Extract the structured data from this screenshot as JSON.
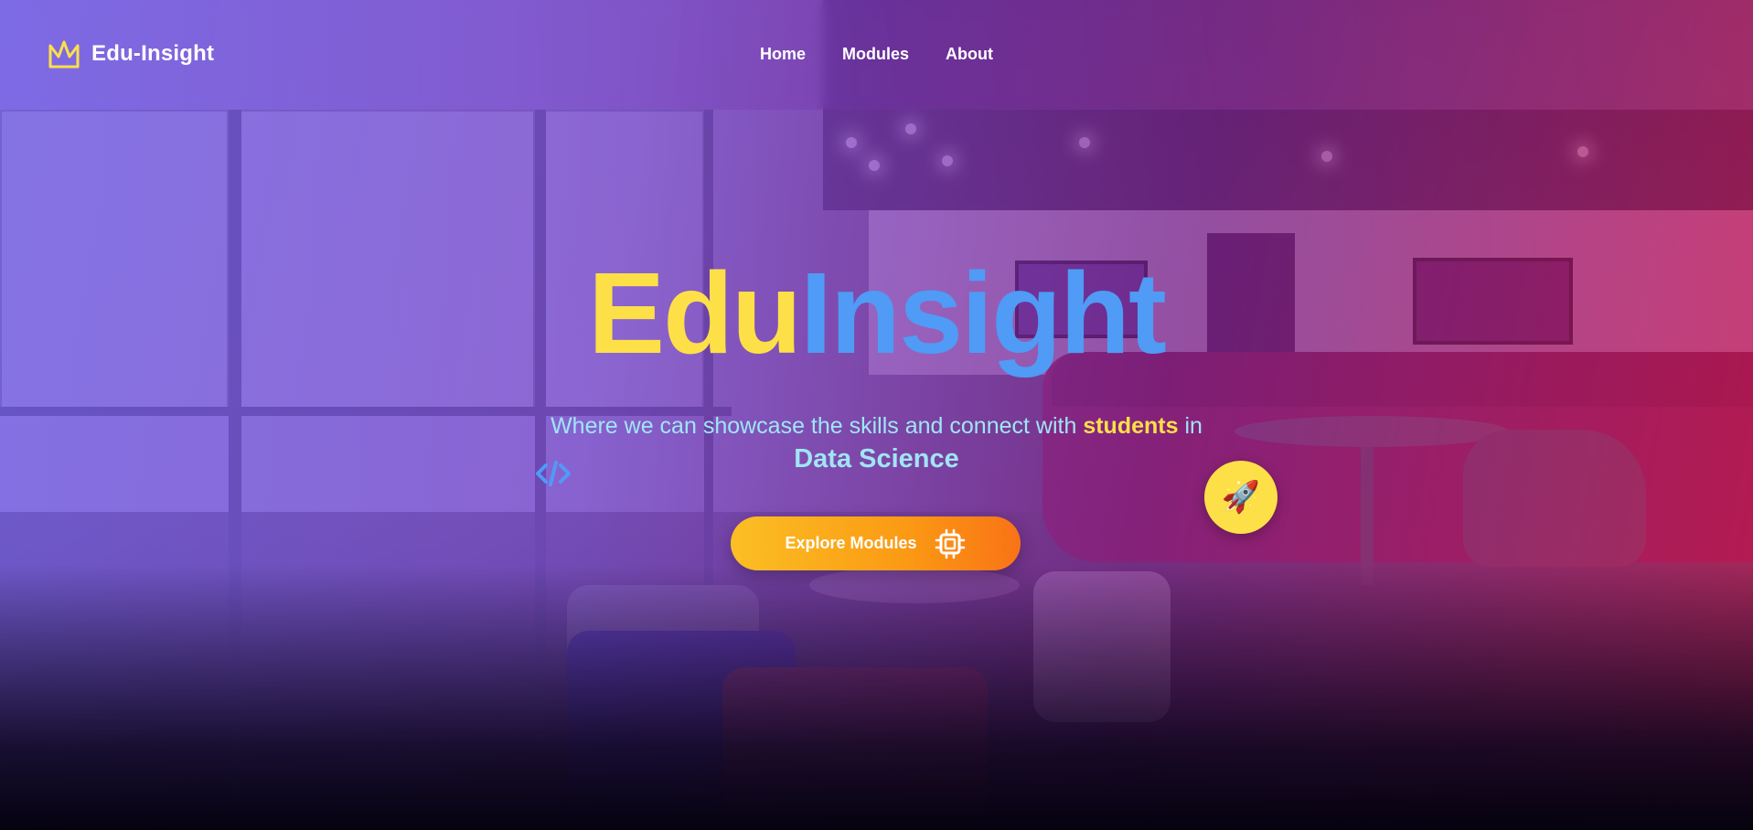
{
  "brand": {
    "name": "Edu-Insight",
    "icon": "crown-icon",
    "icon_color": "#fde047"
  },
  "nav": {
    "items": [
      {
        "label": "Home"
      },
      {
        "label": "Modules"
      },
      {
        "label": "About"
      }
    ]
  },
  "hero": {
    "title_part1": "Edu",
    "title_part2": "Insight",
    "title_color1": "#fde047",
    "title_color2": "#4f9bf5",
    "tagline_before": "Where we can showcase the skills and connect with ",
    "tagline_highlight": "students",
    "tagline_after": " in",
    "subject": "Data Science",
    "cta_label": "Explore Modules",
    "cta_icon": "chip-icon",
    "cta_gradient": [
      "#fbbf24",
      "#f97316"
    ]
  },
  "decorations": {
    "code_icon": "code-icon",
    "rocket_badge": "🚀",
    "badge_color": "#fde047"
  }
}
